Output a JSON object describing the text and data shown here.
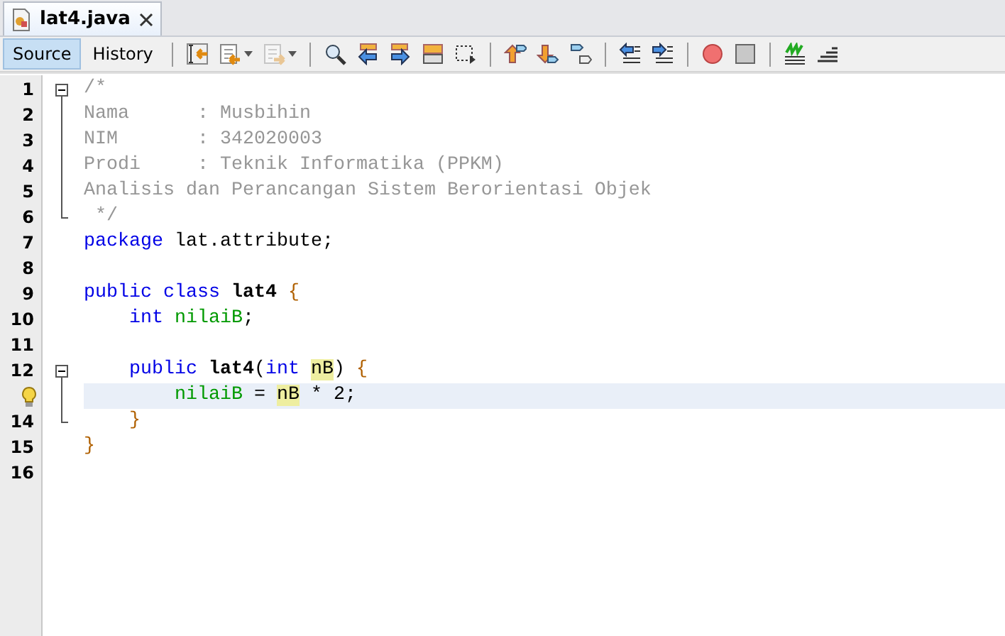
{
  "tab": {
    "title": "lat4.java",
    "selected": true
  },
  "views": [
    {
      "label": "Source",
      "selected": true
    },
    {
      "label": "History",
      "selected": false
    }
  ],
  "toolbar": [
    [
      {
        "disabled": false,
        "dropdown": false
      },
      {
        "disabled": false,
        "dropdown": true
      },
      {
        "disabled": true,
        "dropdown": true
      }
    ],
    [
      {
        "disabled": false,
        "dropdown": false
      },
      {
        "disabled": false,
        "dropdown": false
      },
      {
        "disabled": false,
        "dropdown": false
      },
      {
        "disabled": false,
        "dropdown": false
      },
      {
        "disabled": false,
        "dropdown": false
      }
    ],
    [
      {
        "disabled": false,
        "dropdown": false
      },
      {
        "disabled": false,
        "dropdown": false
      },
      {
        "disabled": false,
        "dropdown": false
      }
    ],
    [
      {
        "disabled": false,
        "dropdown": false
      },
      {
        "disabled": false,
        "dropdown": false
      }
    ],
    [
      {
        "disabled": false,
        "dropdown": false
      },
      {
        "disabled": false,
        "dropdown": false
      }
    ],
    [
      {
        "disabled": false,
        "dropdown": false
      },
      {
        "disabled": false,
        "dropdown": false
      }
    ]
  ],
  "lines": [
    {
      "number": "1",
      "fold_start": true,
      "fold_inside": false,
      "fold_end": false,
      "current": false,
      "hint": false,
      "tokens": [
        {
          "kind": "comment",
          "text": "/*"
        }
      ]
    },
    {
      "number": "2",
      "fold_start": false,
      "fold_inside": true,
      "fold_end": false,
      "current": false,
      "hint": false,
      "tokens": [
        {
          "kind": "comment",
          "text": "Nama      : Musbihin"
        }
      ]
    },
    {
      "number": "3",
      "fold_start": false,
      "fold_inside": true,
      "fold_end": false,
      "current": false,
      "hint": false,
      "tokens": [
        {
          "kind": "comment",
          "text": "NIM       : 342020003"
        }
      ]
    },
    {
      "number": "4",
      "fold_start": false,
      "fold_inside": true,
      "fold_end": false,
      "current": false,
      "hint": false,
      "tokens": [
        {
          "kind": "comment",
          "text": "Prodi     : Teknik Informatika (PPKM)"
        }
      ]
    },
    {
      "number": "5",
      "fold_start": false,
      "fold_inside": true,
      "fold_end": false,
      "current": false,
      "hint": false,
      "tokens": [
        {
          "kind": "comment",
          "text": "Analisis dan Perancangan Sistem Berorientasi Objek"
        }
      ]
    },
    {
      "number": "6",
      "fold_start": false,
      "fold_inside": false,
      "fold_end": true,
      "current": false,
      "hint": false,
      "tokens": [
        {
          "kind": "comment",
          "text": " */"
        }
      ]
    },
    {
      "number": "7",
      "fold_start": false,
      "fold_inside": false,
      "fold_end": false,
      "current": false,
      "hint": false,
      "tokens": [
        {
          "kind": "keyword",
          "text": "package "
        },
        {
          "kind": "plain",
          "text": "lat.attribute;"
        }
      ]
    },
    {
      "number": "8",
      "fold_start": false,
      "fold_inside": false,
      "fold_end": false,
      "current": false,
      "hint": false
    },
    {
      "number": "9",
      "fold_start": false,
      "fold_inside": false,
      "fold_end": false,
      "current": false,
      "hint": false,
      "tokens": [
        {
          "kind": "keyword",
          "text": "public class "
        },
        {
          "kind": "name",
          "text": "lat4 "
        },
        {
          "kind": "brace",
          "text": "{"
        }
      ]
    },
    {
      "number": "10",
      "fold_start": false,
      "fold_inside": false,
      "fold_end": false,
      "current": false,
      "hint": false,
      "tokens": [
        {
          "kind": "keyword",
          "text": "    int "
        },
        {
          "kind": "field",
          "text": "nilaiB"
        },
        {
          "kind": "plain",
          "text": ";"
        }
      ]
    },
    {
      "number": "11",
      "fold_start": false,
      "fold_inside": false,
      "fold_end": false,
      "current": false,
      "hint": false
    },
    {
      "number": "12",
      "fold_start": true,
      "fold_inside": false,
      "fold_end": false,
      "current": false,
      "hint": false,
      "tokens": [
        {
          "kind": "keyword",
          "text": "    public "
        },
        {
          "kind": "name",
          "text": "lat4"
        },
        {
          "kind": "plain",
          "text": "("
        },
        {
          "kind": "keyword",
          "text": "int "
        },
        {
          "kind": "param",
          "text": "nB"
        },
        {
          "kind": "plain",
          "text": ") "
        },
        {
          "kind": "brace",
          "text": "{"
        }
      ]
    },
    {
      "fold_start": false,
      "fold_inside": true,
      "fold_end": false,
      "current": true,
      "hint": true,
      "tokens": [
        {
          "kind": "field",
          "text": "        nilaiB"
        },
        {
          "kind": "plain",
          "text": " = "
        },
        {
          "kind": "param",
          "text": "nB"
        },
        {
          "kind": "plain",
          "text": " * 2;"
        }
      ]
    },
    {
      "number": "14",
      "fold_start": false,
      "fold_inside": false,
      "fold_end": true,
      "current": false,
      "hint": false,
      "tokens": [
        {
          "kind": "brace",
          "text": "    }"
        }
      ]
    },
    {
      "number": "15",
      "fold_start": false,
      "fold_inside": false,
      "fold_end": false,
      "current": false,
      "hint": false,
      "tokens": [
        {
          "kind": "brace",
          "text": "}"
        }
      ]
    },
    {
      "number": "16",
      "fold_start": false,
      "fold_inside": false,
      "fold_end": false,
      "current": false,
      "hint": false
    }
  ]
}
